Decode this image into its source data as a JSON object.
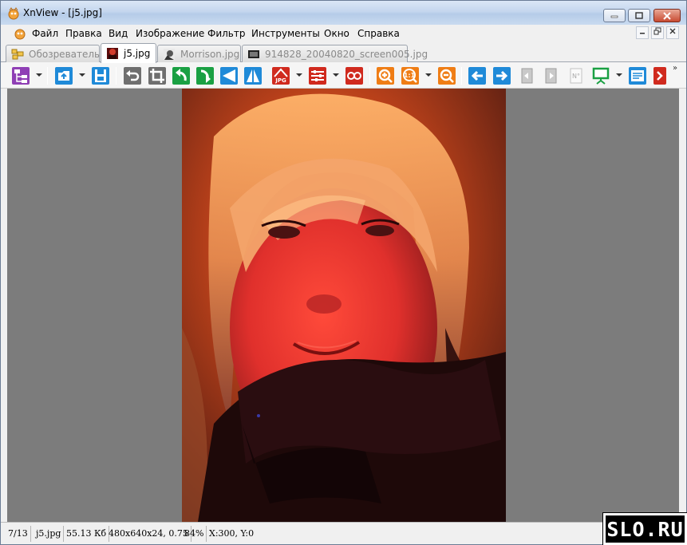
{
  "window": {
    "title": "XnView - [j5.jpg]",
    "controls": {
      "minimize": "minimize",
      "maximize": "maximize",
      "close": "close"
    }
  },
  "menu": {
    "items": [
      "Файл",
      "Правка",
      "Вид",
      "Изображение",
      "Фильтр",
      "Инструменты",
      "Окно",
      "Справка"
    ]
  },
  "tabs": [
    {
      "label": "Обозреватель",
      "active": false,
      "icon": "folders-icon"
    },
    {
      "label": "j5.jpg",
      "active": true,
      "icon": "image-thumb-icon"
    },
    {
      "label": "Morrison.jpg",
      "active": false,
      "icon": "image-thumb-icon"
    },
    {
      "label": "914828_20040820_screen005.jpg",
      "active": false,
      "icon": "image-thumb-icon"
    }
  ],
  "toolbar": {
    "more_label": "»",
    "buttons": [
      "browser-tree-icon",
      "open-icon",
      "save-icon",
      "undo-icon",
      "crop-icon",
      "rotate-left-icon",
      "rotate-right-icon",
      "flip-horizontal-icon",
      "flip-vertical-icon",
      "jpeg-lossless-icon",
      "adjust-icon",
      "red-eye-icon",
      "zoom-in-icon",
      "zoom-actual-icon",
      "zoom-out-icon",
      "previous-icon",
      "next-icon",
      "first-page-icon",
      "last-page-icon",
      "page-number-icon",
      "slideshow-icon",
      "properties-icon",
      "exit-icon"
    ]
  },
  "colors": {
    "view_background": "#7c7c7c",
    "toolbar_blue": "#1f8ad8",
    "toolbar_green": "#1aa043",
    "toolbar_orange": "#ef7d15",
    "toolbar_red": "#d02a1e"
  },
  "statusbar": {
    "index": "7/13",
    "filename": "j5.jpg",
    "filesize": "55.13 Кб",
    "dimensions": "480x640x24, 0.75",
    "zoom": "84%",
    "coords": "X:300, Y:0"
  },
  "watermark": "SLO.RU"
}
